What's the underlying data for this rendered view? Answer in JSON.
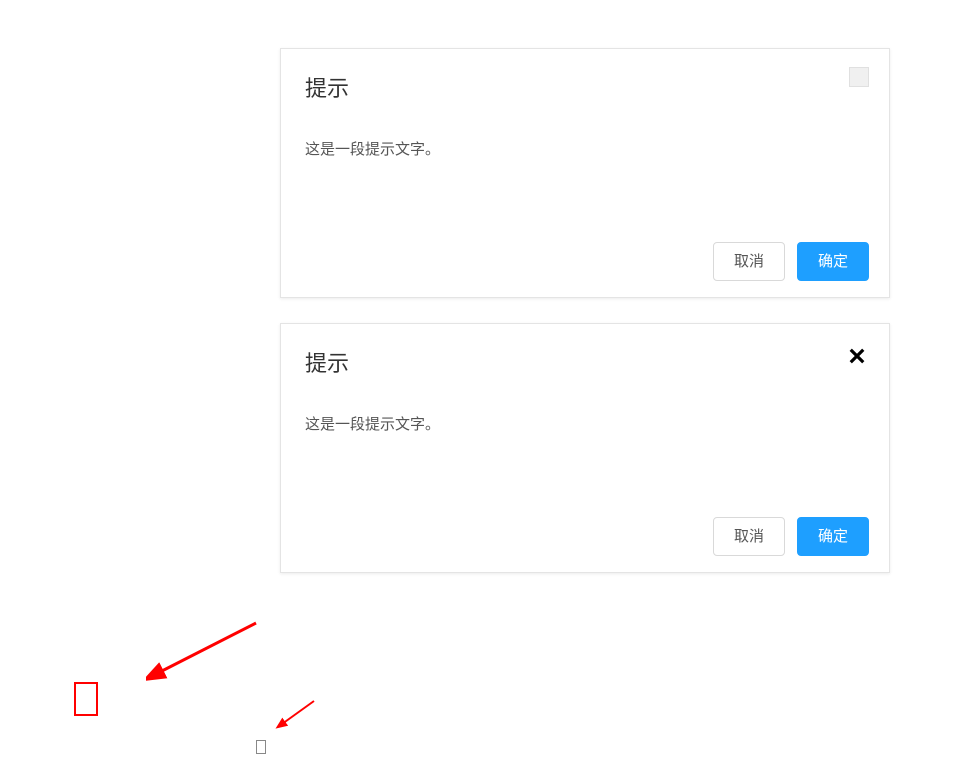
{
  "dialog1": {
    "title": "提示",
    "message": "这是一段提示文字。",
    "cancel_label": "取消",
    "confirm_label": "确定"
  },
  "dialog2": {
    "title": "提示",
    "message": "这是一段提示文字。",
    "cancel_label": "取消",
    "confirm_label": "确定"
  },
  "colors": {
    "primary": "#1e9fff",
    "arrow": "#ff0000"
  }
}
